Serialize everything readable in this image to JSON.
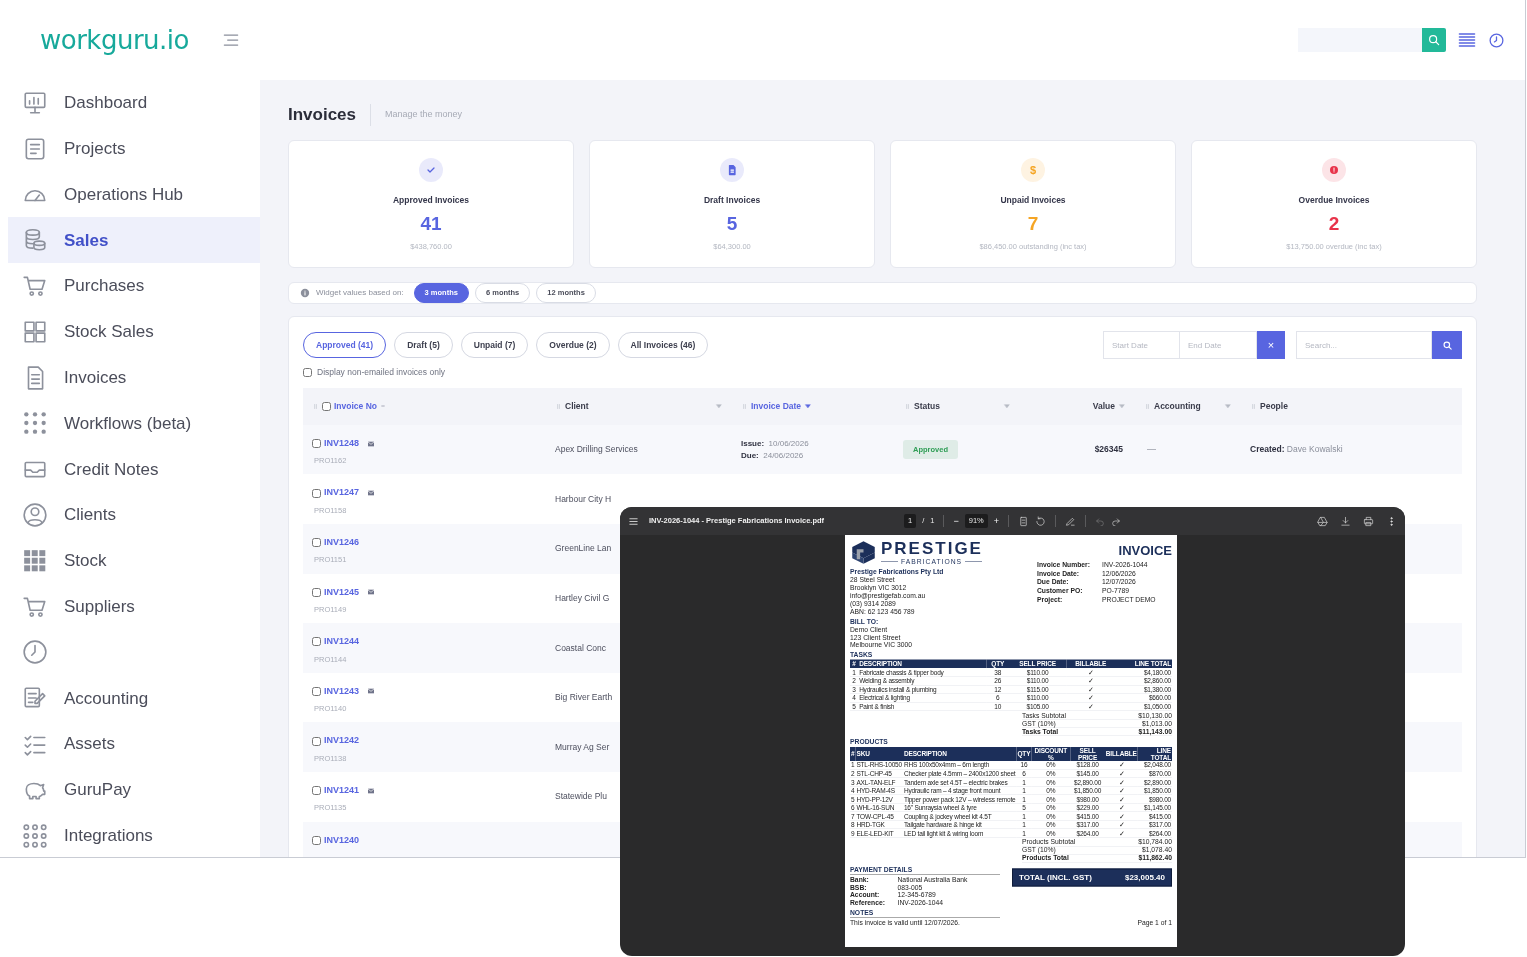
{
  "header": {
    "logo": "workguru.io"
  },
  "sidebar": {
    "items": [
      {
        "label": "Dashboard",
        "selected": false
      },
      {
        "label": "Projects",
        "selected": false
      },
      {
        "label": "Operations Hub",
        "selected": false
      },
      {
        "label": "Sales",
        "selected": true
      },
      {
        "label": "Purchases",
        "selected": false
      },
      {
        "label": "Stock Sales",
        "selected": false
      },
      {
        "label": "Invoices",
        "selected": false
      },
      {
        "label": "Workflows (beta)",
        "selected": false
      },
      {
        "label": "Credit Notes",
        "selected": false
      },
      {
        "label": "Clients",
        "selected": false
      },
      {
        "label": "Stock",
        "selected": false
      },
      {
        "label": "Suppliers",
        "selected": false
      },
      {
        "selected": false
      },
      {
        "label": "Accounting",
        "selected": false
      },
      {
        "label": "Assets",
        "selected": false
      },
      {
        "label": "GuruPay",
        "selected": false
      },
      {
        "label": "Integrations",
        "selected": false
      }
    ]
  },
  "page": {
    "title": "Invoices",
    "subtitle": "Manage the money"
  },
  "stats": [
    {
      "title": "Approved Invoices",
      "count": "41",
      "amount": "$438,760.00",
      "color": "#5865e0"
    },
    {
      "title": "Draft Invoices",
      "count": "5",
      "amount": "$64,300.00",
      "color": "#5865e0"
    },
    {
      "title": "Unpaid Invoices",
      "count": "7",
      "amount": "$86,450.00 outstanding (inc tax)",
      "color": "#f5a524",
      "symbol": "$"
    },
    {
      "title": "Overdue Invoices",
      "count": "2",
      "amount": "$13,750.00 overdue (inc tax)",
      "color": "#e8334a"
    }
  ],
  "widget": {
    "label": "Widget values based on:",
    "periods": [
      {
        "label": "3 months",
        "selected": true
      },
      {
        "label": "6 months",
        "selected": false
      },
      {
        "label": "12 months",
        "selected": false
      }
    ]
  },
  "filters": [
    {
      "label": "Approved (41)",
      "selected": true
    },
    {
      "label": "Draft (5)",
      "selected": false
    },
    {
      "label": "Unpaid (7)",
      "selected": false
    },
    {
      "label": "Overdue (2)",
      "selected": false
    },
    {
      "label": "All Invoices (46)",
      "selected": false
    }
  ],
  "date_range": {
    "start": {
      "placeholder": "Start Date"
    },
    "end": {
      "placeholder": "End Date"
    },
    "clear": "×"
  },
  "search": {
    "placeholder": "Search..."
  },
  "non_emailed": {
    "label": "Display non-emailed invoices only",
    "checked": false
  },
  "table": {
    "select_all": {
      "checked": false
    },
    "columns": [
      {
        "label": "Invoice No",
        "kind": "sortable",
        "active": true,
        "draggable": true,
        "sorted": false,
        "filter": false
      },
      {
        "label": "Client",
        "kind": "plain",
        "active": false,
        "draggable": true,
        "filter": true
      },
      {
        "label": "Invoice Date",
        "kind": "sortable",
        "active": true,
        "draggable": true,
        "sorted": true,
        "filter": false
      },
      {
        "label": "Status",
        "kind": "plain",
        "active": false,
        "draggable": true,
        "filter": true
      },
      {
        "label": "Value",
        "kind": "number",
        "active": false,
        "draggable": false,
        "filter": true
      },
      {
        "label": "Accounting",
        "kind": "plain",
        "active": false,
        "draggable": true,
        "filter": true
      },
      {
        "label": "People",
        "kind": "plain",
        "active": false,
        "draggable": true,
        "filter": false
      }
    ],
    "rows": [
      {
        "checked": false,
        "invoice": "INV1248",
        "emailed": true,
        "project": "PRO1162",
        "client": "Apex Drilling Services",
        "issue": "**Issue:**  10/06/2026",
        "due": "**Due:**  24/06/2026",
        "status": {
          "label": "Approved",
          "color": "#2e9d55"
        },
        "value": "$26345",
        "accounting": "—",
        "people": "**Created:** Dave Kowalski"
      },
      {
        "checked": false,
        "invoice": "INV1247",
        "emailed": true,
        "project": "PRO1158",
        "client": "Harbour City H"
      },
      {
        "checked": false,
        "invoice": "INV1246",
        "emailed": false,
        "project": "PRO1151",
        "client": "GreenLine Lan"
      },
      {
        "checked": false,
        "invoice": "INV1245",
        "emailed": true,
        "project": "PRO1149",
        "client": "Hartley Civil G"
      },
      {
        "checked": false,
        "invoice": "INV1244",
        "emailed": false,
        "project": "PRO1144",
        "client": "Coastal Conc"
      },
      {
        "checked": false,
        "invoice": "INV1243",
        "emailed": true,
        "project": "PRO1140",
        "client": "Big River Earth"
      },
      {
        "checked": false,
        "invoice": "INV1242",
        "emailed": false,
        "project": "PRO1138",
        "client": "Murray Ag Ser"
      },
      {
        "checked": false,
        "invoice": "INV1241",
        "emailed": true,
        "project": "PRO1135",
        "client": "Statewide Plu"
      },
      {
        "checked": false,
        "invoice": "INV1240",
        "emailed": false
      }
    ]
  },
  "viewer": {
    "filename": "INV-2026-1044 - Prestige Fabrications Invoice.pdf",
    "page": "1",
    "separator": "/",
    "pages": "1",
    "zoom_out": "−",
    "zoom": "91%",
    "zoom_in": "+",
    "document": {
      "brand": "PRESTIGE",
      "brand_sub": "FABRICATIONS",
      "heading": "INVOICE",
      "company": [
        "Prestige Fabrications Pty Ltd",
        "28 Steel Street",
        "Brooklyn VIC 3012",
        "info@prestigefab.com.au",
        "(03) 9314 2089",
        "ABN: 62 123 456 789"
      ],
      "meta": [
        {
          "label": "Invoice Number:",
          "value": "INV-2026-1044"
        },
        {
          "label": "Invoice Date:",
          "value": "12/06/2026"
        },
        {
          "label": "Due Date:",
          "value": "12/07/2026"
        },
        {
          "label": "Customer PO:",
          "value": "PO-7789"
        },
        {
          "label": "Project:",
          "value": "PROJECT DEMO"
        }
      ],
      "bill_to": {
        "heading": "BILL TO:",
        "lines": [
          "Demo Client",
          "123 Client Street",
          "Melbourne VIC 3000"
        ]
      },
      "tasks": {
        "heading": "TASKS",
        "columns": [
          "#",
          "DESCRIPTION",
          "QTY",
          "SELL PRICE",
          "BILLABLE",
          "LINE TOTAL"
        ],
        "rows": [
          [
            "1",
            "Fabricate chassis & tipper body",
            "38",
            "$110.00",
            "✓",
            "$4,180.00"
          ],
          [
            "2",
            "Welding & assembly",
            "26",
            "$110.00",
            "✓",
            "$2,860.00"
          ],
          [
            "3",
            "Hydraulics install & plumbing",
            "12",
            "$115.00",
            "✓",
            "$1,380.00"
          ],
          [
            "4",
            "Electrical & lighting",
            "6",
            "$110.00",
            "✓",
            "$660.00"
          ],
          [
            "5",
            "Paint & finish",
            "10",
            "$105.00",
            "✓",
            "$1,050.00"
          ]
        ],
        "totals": [
          {
            "label": "Tasks Subtotal",
            "value": "$10,130.00",
            "bold": false
          },
          {
            "label": "GST (10%)",
            "value": "$1,013.00",
            "bold": false
          },
          {
            "label": "Tasks Total",
            "value": "$11,143.00",
            "bold": true
          }
        ]
      },
      "products": {
        "heading": "PRODUCTS",
        "columns": [
          "#",
          "SKU",
          "DESCRIPTION",
          "QTY",
          "DISCOUNT %",
          "SELL PRICE",
          "BILLABLE",
          "LINE TOTAL"
        ],
        "rows": [
          [
            "1",
            "STL-RHS-10050",
            "RHS 100x50x4mm – 6m length",
            "16",
            "0%",
            "$128.00",
            "✓",
            "$2,048.00"
          ],
          [
            "2",
            "STL-CHP-45",
            "Checker plate 4.5mm – 2400x1200 sheet",
            "6",
            "0%",
            "$145.00",
            "✓",
            "$870.00"
          ],
          [
            "3",
            "AXL-TAN-ELF",
            "Tandem axle set 4.5T – electric brakes",
            "1",
            "0%",
            "$2,890.00",
            "✓",
            "$2,890.00"
          ],
          [
            "4",
            "HYD-RAM-4S",
            "Hydraulic ram – 4 stage front mount",
            "1",
            "0%",
            "$1,850.00",
            "✓",
            "$1,850.00"
          ],
          [
            "5",
            "HYD-PP-12V",
            "Tipper power pack 12V – wireless remote",
            "1",
            "0%",
            "$980.00",
            "✓",
            "$980.00"
          ],
          [
            "6",
            "WHL-16-SUN",
            "16\" Sunraysia wheel & tyre",
            "5",
            "0%",
            "$229.00",
            "✓",
            "$1,145.00"
          ],
          [
            "7",
            "TOW-CPL-45",
            "Coupling & jockey wheel kit 4.5T",
            "1",
            "0%",
            "$415.00",
            "✓",
            "$415.00"
          ],
          [
            "8",
            "HRD-TGK",
            "Tailgate hardware & hinge kit",
            "1",
            "0%",
            "$317.00",
            "✓",
            "$317.00"
          ],
          [
            "9",
            "ELE-LED-KIT",
            "LED tail light kit & wiring loom",
            "1",
            "0%",
            "$264.00",
            "✓",
            "$264.00"
          ]
        ],
        "totals": [
          {
            "label": "Products Subtotal",
            "value": "$10,784.00",
            "bold": false
          },
          {
            "label": "GST (10%)",
            "value": "$1,078.40",
            "bold": false
          },
          {
            "label": "Products Total",
            "value": "$11,862.40",
            "bold": true
          }
        ]
      },
      "payment": {
        "heading": "PAYMENT DETAILS",
        "rows": [
          {
            "label": "Bank:",
            "value": "National Australia Bank"
          },
          {
            "label": "BSB:",
            "value": "083-005"
          },
          {
            "label": "Account:",
            "value": "12-345-6789"
          },
          {
            "label": "Reference:",
            "value": "INV-2026-1044"
          }
        ]
      },
      "notes": {
        "heading": "NOTES",
        "text": "This invoice is valid until 12/07/2026."
      },
      "grand_total": {
        "label": "TOTAL (INCL. GST)",
        "value": "$23,005.40"
      },
      "page_label": "Page 1 of 1"
    }
  }
}
